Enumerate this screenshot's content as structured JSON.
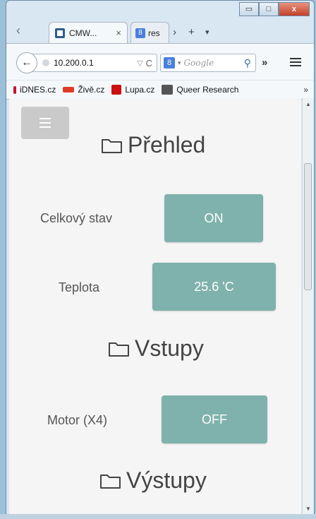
{
  "browser": {
    "tabs": [
      {
        "label": "CMW...",
        "close": "×"
      },
      {
        "label": "res"
      }
    ],
    "tab_more": "›",
    "new_tab": "+",
    "tab_list": "▾",
    "window_controls": {
      "minimize": "▭",
      "maximize": "□",
      "close": "x"
    },
    "back": "←",
    "address": "10.200.0.1",
    "reload": "C",
    "search_engine_icon": "8",
    "search_placeholder": "Google",
    "overflow": "»",
    "bookmarks": [
      {
        "label": "iDNES.cz",
        "color": "#c8102e"
      },
      {
        "label": "Živě.cz",
        "color": "#e03a28"
      },
      {
        "label": "Lupa.cz",
        "color": "#cc1010"
      },
      {
        "label": "Queer Research",
        "color": "#555555"
      }
    ],
    "bookmark_more": "»"
  },
  "app": {
    "sections": [
      {
        "title": "Přehled"
      },
      {
        "title": "Vstupy"
      },
      {
        "title": "Výstupy"
      }
    ],
    "rows": [
      {
        "label": "Celkový stav",
        "value": "ON"
      },
      {
        "label": "Teplota",
        "value": "25.6 'C"
      },
      {
        "label": "Motor (X4)",
        "value": "OFF"
      }
    ],
    "accent": "#7fb2ac"
  }
}
